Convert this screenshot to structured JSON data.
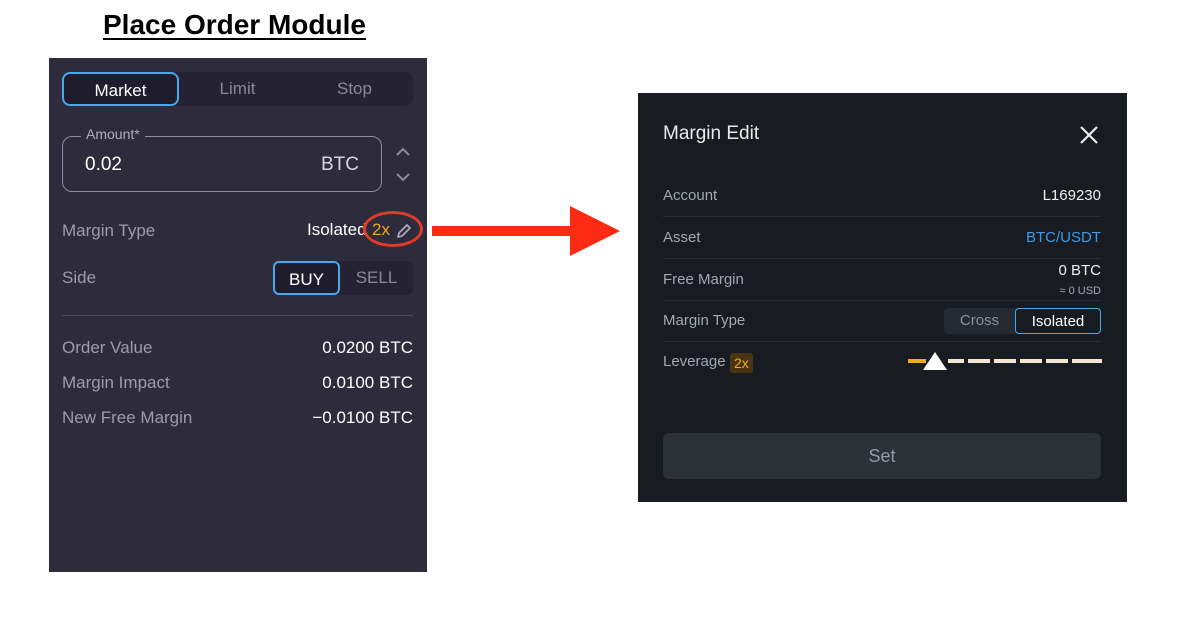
{
  "heading": "Place Order Module",
  "order": {
    "tabs": [
      {
        "label": "Market",
        "active": true
      },
      {
        "label": "Limit",
        "active": false
      },
      {
        "label": "Stop",
        "active": false
      }
    ],
    "amount": {
      "label": "Amount*",
      "value": "0.02",
      "unit": "BTC"
    },
    "margin_type": {
      "label": "Margin Type",
      "value": "Isolated",
      "leverage": "2x"
    },
    "side": {
      "label": "Side",
      "buy": "BUY",
      "sell": "SELL",
      "selected": "BUY"
    },
    "summary": [
      {
        "label": "Order Value",
        "value": "0.0200 BTC"
      },
      {
        "label": "Margin Impact",
        "value": "0.0100 BTC"
      },
      {
        "label": "New Free Margin",
        "value": "−0.0100 BTC"
      }
    ]
  },
  "margin_edit": {
    "title": "Margin Edit",
    "account": {
      "label": "Account",
      "value": "L169230"
    },
    "asset": {
      "label": "Asset",
      "value": "BTC/USDT"
    },
    "free_margin": {
      "label": "Free Margin",
      "value": "0 BTC",
      "sub": "≈ 0 USD"
    },
    "margin_type": {
      "label": "Margin Type",
      "options": [
        "Cross",
        "Isolated"
      ],
      "selected": "Isolated"
    },
    "leverage": {
      "label": "Leverage",
      "value": "2x"
    },
    "set_label": "Set"
  },
  "colors": {
    "accent": "#4aa7e8",
    "leverage": "#f5a623",
    "highlight": "#e03a2a",
    "link": "#3d9be9"
  }
}
